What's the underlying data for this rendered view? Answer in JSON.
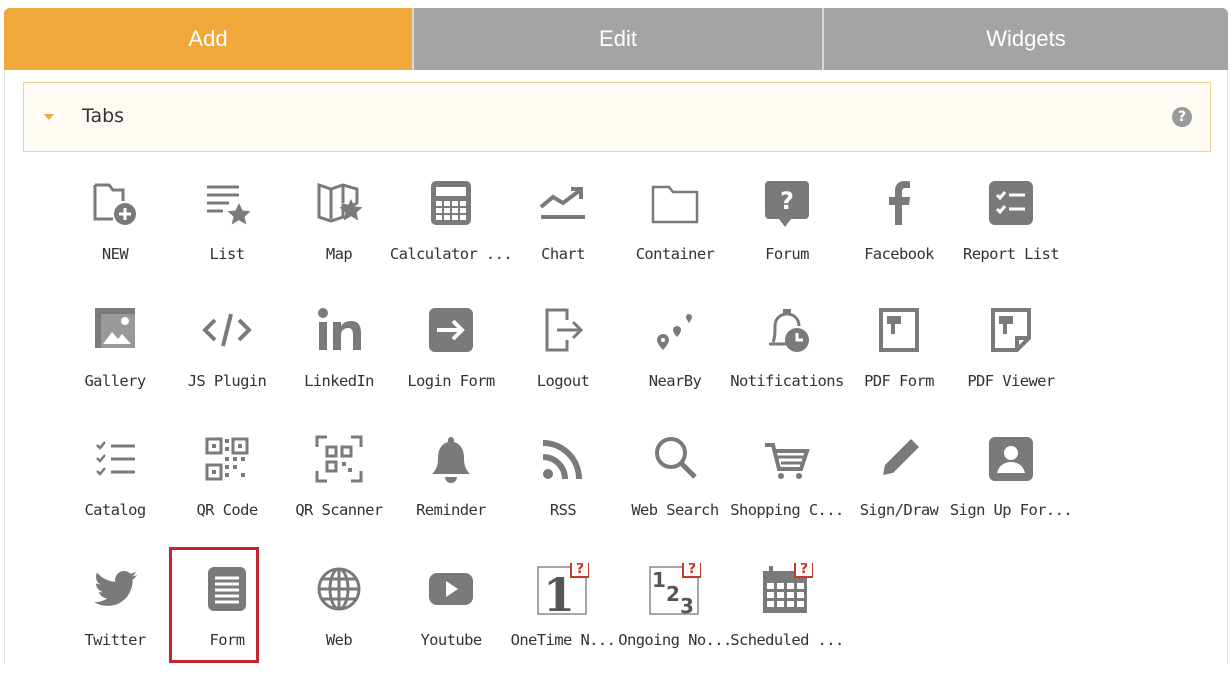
{
  "tabs": [
    {
      "label": "Add",
      "active": true
    },
    {
      "label": "Edit",
      "active": false
    },
    {
      "label": "Widgets",
      "active": false
    }
  ],
  "section": {
    "title": "Tabs",
    "help": "?"
  },
  "widgets": [
    {
      "label": "NEW",
      "icon": "new-page-icon"
    },
    {
      "label": "List",
      "icon": "list-icon"
    },
    {
      "label": "Map",
      "icon": "map-icon"
    },
    {
      "label": "Calculator ...",
      "icon": "calculator-icon"
    },
    {
      "label": "Chart",
      "icon": "chart-icon"
    },
    {
      "label": "Container",
      "icon": "folder-icon"
    },
    {
      "label": "Forum",
      "icon": "forum-icon"
    },
    {
      "label": "Facebook",
      "icon": "facebook-icon"
    },
    {
      "label": "Report List",
      "icon": "report-list-icon"
    },
    {
      "label": "Gallery",
      "icon": "gallery-icon"
    },
    {
      "label": "JS Plugin",
      "icon": "code-icon"
    },
    {
      "label": "LinkedIn",
      "icon": "linkedin-icon"
    },
    {
      "label": "Login Form",
      "icon": "login-icon"
    },
    {
      "label": "Logout",
      "icon": "logout-icon"
    },
    {
      "label": "NearBy",
      "icon": "nearby-icon"
    },
    {
      "label": "Notifications",
      "icon": "notifications-icon"
    },
    {
      "label": "PDF Form",
      "icon": "pdf-form-icon"
    },
    {
      "label": "PDF Viewer",
      "icon": "pdf-viewer-icon"
    },
    {
      "label": "Catalog",
      "icon": "catalog-icon"
    },
    {
      "label": "QR Code",
      "icon": "qr-code-icon"
    },
    {
      "label": "QR Scanner",
      "icon": "qr-scanner-icon"
    },
    {
      "label": "Reminder",
      "icon": "bell-icon"
    },
    {
      "label": "RSS",
      "icon": "rss-icon"
    },
    {
      "label": "Web Search",
      "icon": "search-icon"
    },
    {
      "label": "Shopping C...",
      "icon": "shopping-cart-icon"
    },
    {
      "label": "Sign/Draw",
      "icon": "pencil-icon"
    },
    {
      "label": "Sign Up For...",
      "icon": "sign-up-icon"
    },
    {
      "label": "Twitter",
      "icon": "twitter-icon"
    },
    {
      "label": "Form",
      "icon": "form-icon",
      "selected": true
    },
    {
      "label": "Web",
      "icon": "globe-icon"
    },
    {
      "label": "Youtube",
      "icon": "youtube-icon"
    },
    {
      "label": "OneTime N...",
      "icon": "one-time-notification-icon"
    },
    {
      "label": "Ongoing No...",
      "icon": "ongoing-notification-icon"
    },
    {
      "label": "Scheduled ...",
      "icon": "scheduled-calendar-icon"
    }
  ],
  "colors": {
    "accent": "#f0a83a",
    "tab_inactive": "#a4a4a4",
    "icon": "#7a7a7a",
    "selection": "#c0272d",
    "badge": "#c0392b"
  }
}
